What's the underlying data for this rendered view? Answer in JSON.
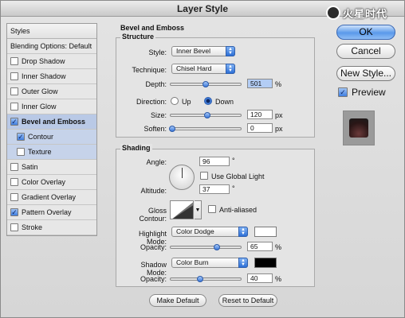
{
  "window": {
    "title": "Layer Style",
    "watermark": "火星时代"
  },
  "styles_list": {
    "header": "Styles",
    "blending_options": "Blending Options: Default",
    "items": [
      {
        "label": "Drop Shadow",
        "checked": false
      },
      {
        "label": "Inner Shadow",
        "checked": false
      },
      {
        "label": "Outer Glow",
        "checked": false
      },
      {
        "label": "Inner Glow",
        "checked": false
      },
      {
        "label": "Bevel and Emboss",
        "checked": true,
        "selected": true
      },
      {
        "label": "Contour",
        "checked": true,
        "sub": true
      },
      {
        "label": "Texture",
        "checked": false,
        "sub": true
      },
      {
        "label": "Satin",
        "checked": false
      },
      {
        "label": "Color Overlay",
        "checked": false
      },
      {
        "label": "Gradient Overlay",
        "checked": false
      },
      {
        "label": "Pattern Overlay",
        "checked": true
      },
      {
        "label": "Stroke",
        "checked": false
      }
    ]
  },
  "bevel": {
    "title": "Bevel and Emboss",
    "structure": {
      "legend": "Structure",
      "style_label": "Style:",
      "style_value": "Inner Bevel",
      "technique_label": "Technique:",
      "technique_value": "Chisel Hard",
      "depth_label": "Depth:",
      "depth_value": "501",
      "depth_unit": "%",
      "direction_label": "Direction:",
      "direction_up": "Up",
      "direction_down": "Down",
      "size_label": "Size:",
      "size_value": "120",
      "size_unit": "px",
      "soften_label": "Soften:",
      "soften_value": "0",
      "soften_unit": "px"
    },
    "shading": {
      "legend": "Shading",
      "angle_label": "Angle:",
      "angle_value": "96",
      "angle_unit": "°",
      "global_light_label": "Use Global Light",
      "altitude_label": "Altitude:",
      "altitude_value": "37",
      "altitude_unit": "°",
      "gloss_contour_label": "Gloss Contour:",
      "anti_aliased_label": "Anti-aliased",
      "highlight_mode_label": "Highlight Mode:",
      "highlight_mode_value": "Color Dodge",
      "highlight_color": "#ffffff",
      "highlight_opacity_label": "Opacity:",
      "highlight_opacity_value": "65",
      "highlight_opacity_unit": "%",
      "shadow_mode_label": "Shadow Mode:",
      "shadow_mode_value": "Color Burn",
      "shadow_color": "#000000",
      "shadow_opacity_label": "Opacity:",
      "shadow_opacity_value": "40",
      "shadow_opacity_unit": "%"
    },
    "make_default": "Make Default",
    "reset_default": "Reset to Default"
  },
  "buttons": {
    "ok": "OK",
    "cancel": "Cancel",
    "new_style": "New Style...",
    "preview": "Preview"
  }
}
